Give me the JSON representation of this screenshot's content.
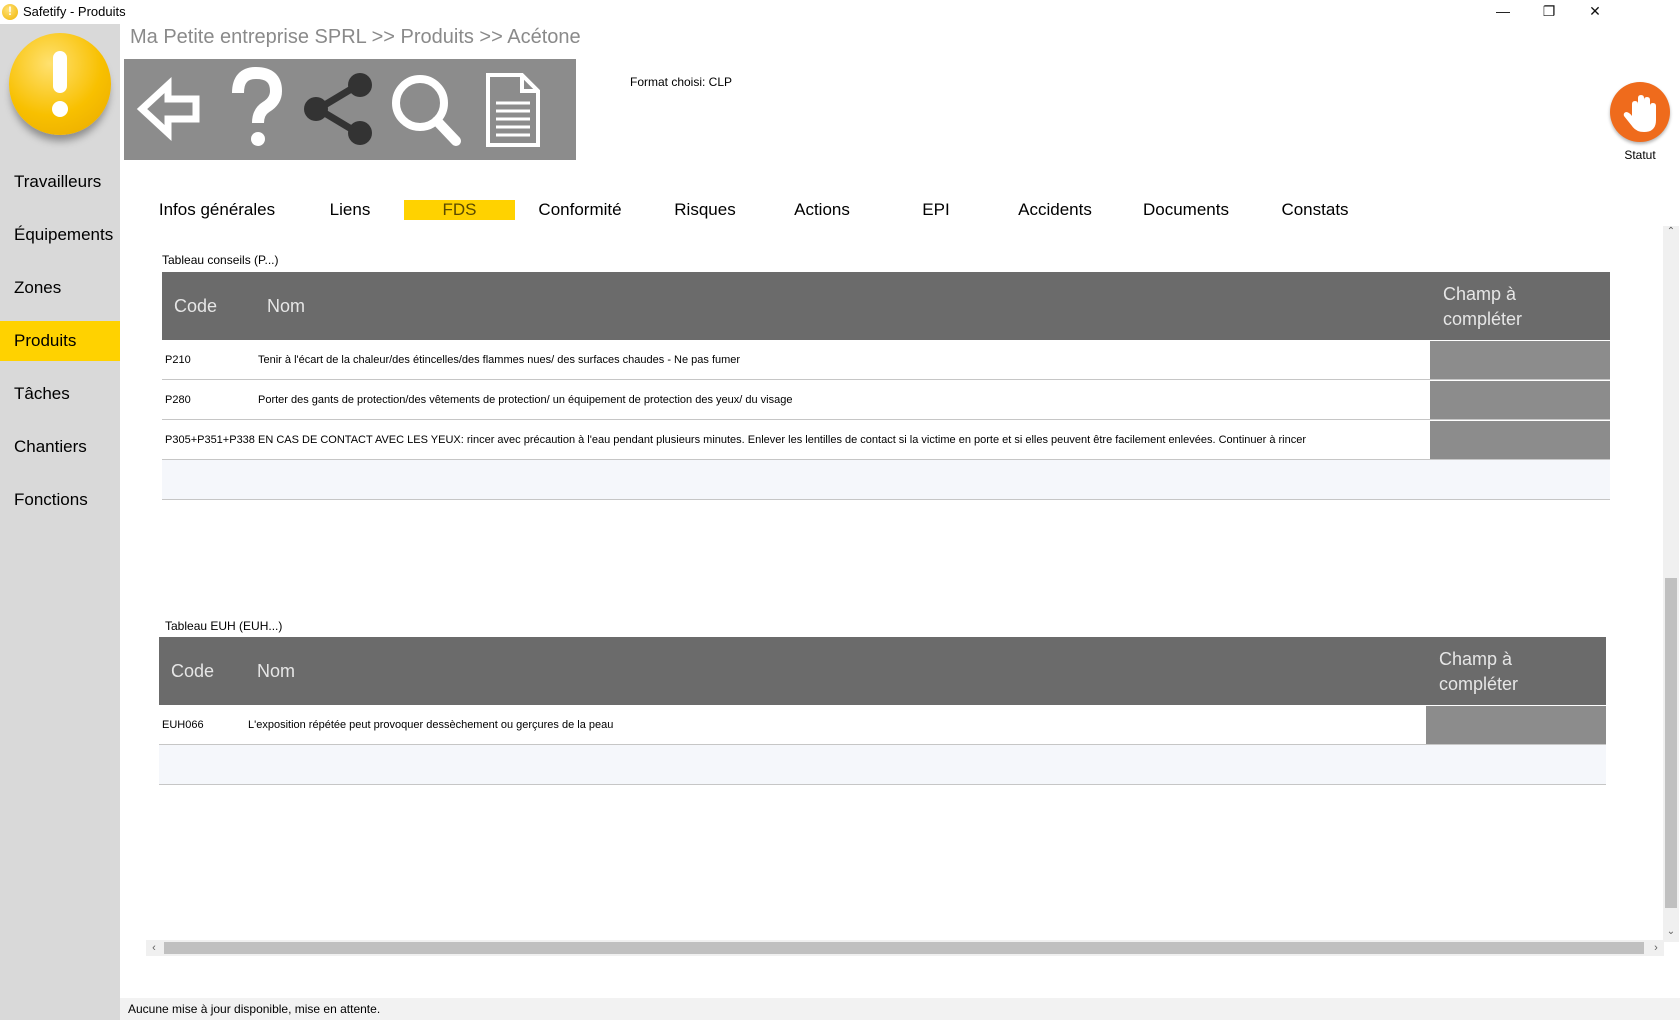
{
  "window": {
    "title": "Safetify - Produits",
    "minimize": "—",
    "restore": "❐",
    "close": "✕"
  },
  "sidebar": {
    "items": [
      {
        "label": "Travailleurs"
      },
      {
        "label": "Équipements"
      },
      {
        "label": "Zones"
      },
      {
        "label": "Produits",
        "active": true
      },
      {
        "label": "Tâches"
      },
      {
        "label": "Chantiers"
      },
      {
        "label": "Fonctions"
      }
    ]
  },
  "breadcrumb": "Ma Petite entreprise SPRL >> Produits >> Acétone",
  "toolbar": {
    "icons": [
      "back-arrow-icon",
      "help-icon",
      "share-icon",
      "search-icon",
      "document-icon"
    ]
  },
  "format_label": "Format choisi: CLP",
  "statut": {
    "label": "Statut",
    "icon": "hand-stop-icon",
    "color": "#ef6b1c"
  },
  "tabs": [
    {
      "label": "Infos générales"
    },
    {
      "label": "Liens"
    },
    {
      "label": "FDS",
      "active": true
    },
    {
      "label": "Conformité"
    },
    {
      "label": "Risques"
    },
    {
      "label": "Actions"
    },
    {
      "label": "EPI"
    },
    {
      "label": "Accidents"
    },
    {
      "label": "Documents"
    },
    {
      "label": "Constats"
    }
  ],
  "table_conseils": {
    "title": "Tableau conseils (P...)",
    "headers": {
      "code": "Code",
      "nom": "Nom",
      "champ_line1": "Champ à",
      "champ_line2": "compléter"
    },
    "rows": [
      {
        "code": "P210",
        "nom": "Tenir à l'écart de la chaleur/des étincelles/des flammes nues/ des surfaces chaudes - Ne pas fumer"
      },
      {
        "code": "P280",
        "nom": "Porter des gants de protection/des vêtements de protection/ un équipement de protection des yeux/ du visage"
      },
      {
        "code": "P305+P351+P338",
        "nom": "EN CAS DE CONTACT AVEC LES YEUX: rincer avec précaution à l'eau pendant plusieurs minutes.  Enlever les lentilles de contact si la victime en porte et si elles peuvent être facilement enlevées.  Continuer à rincer"
      }
    ]
  },
  "table_euh": {
    "title": "Tableau EUH (EUH...)",
    "headers": {
      "code": "Code",
      "nom": "Nom",
      "champ_line1": "Champ à",
      "champ_line2": "compléter"
    },
    "rows": [
      {
        "code": "EUH066",
        "nom": "L'exposition répétée peut provoquer dessèchement ou gerçures de la peau"
      }
    ]
  },
  "scroll": {
    "up": "⌃",
    "down": "⌄",
    "left": "‹",
    "right": "›"
  },
  "status_bar": "Aucune mise à jour disponible, mise en attente.",
  "colors": {
    "accent": "#ffd200",
    "header": "#6b6b6b",
    "toolbar": "#8c8c8c",
    "sidebar": "#d9d9d9"
  }
}
